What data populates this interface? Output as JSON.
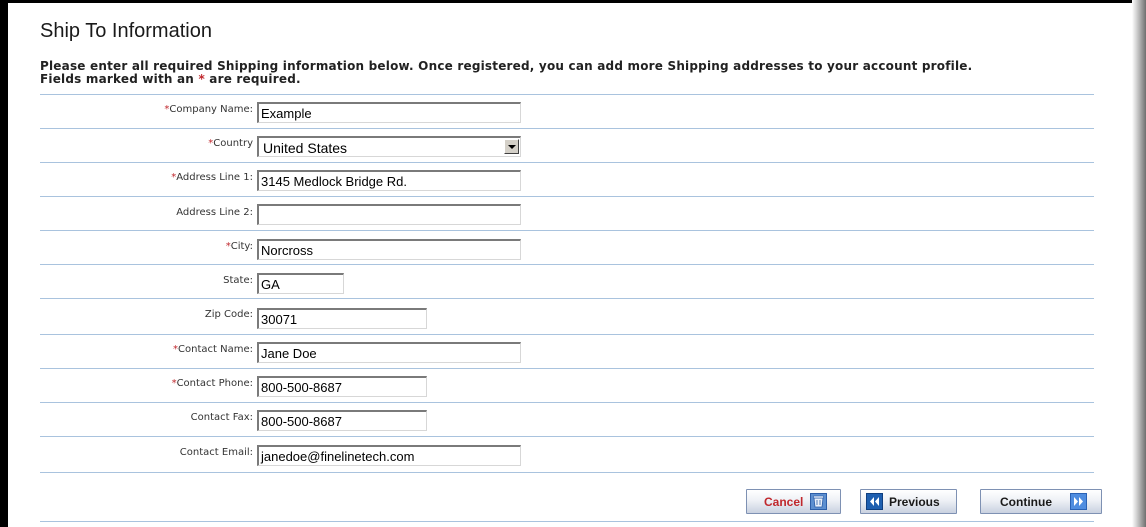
{
  "page": {
    "title": "Ship To Information",
    "intro_line1": "Please enter all required Shipping information below. Once registered, you can add more Shipping addresses to your account profile.",
    "intro_line2_pre": "Fields marked with an ",
    "intro_required_mark": "*",
    "intro_line2_post": " are required."
  },
  "required_mark": "*",
  "fields": {
    "company_name": {
      "label": "Company Name:",
      "value": "Example",
      "required": true
    },
    "country": {
      "label": "Country",
      "value": "United States",
      "required": true
    },
    "address1": {
      "label": "Address Line 1:",
      "value": "3145 Medlock Bridge Rd.",
      "required": true
    },
    "address2": {
      "label": "Address Line 2:",
      "value": "",
      "required": false
    },
    "city": {
      "label": "City:",
      "value": "Norcross",
      "required": true
    },
    "state": {
      "label": "State:",
      "value": "GA",
      "required": false
    },
    "zip": {
      "label": "Zip Code:",
      "value": "30071",
      "required": false
    },
    "contact_name": {
      "label": "Contact Name:",
      "value": "Jane Doe",
      "required": true
    },
    "contact_phone": {
      "label": "Contact Phone:",
      "value": "800-500-8687",
      "required": true
    },
    "contact_fax": {
      "label": "Contact Fax:",
      "value": "800-500-8687",
      "required": false
    },
    "contact_email": {
      "label": "Contact Email:",
      "value": "janedoe@finelinetech.com",
      "required": false
    }
  },
  "buttons": {
    "cancel": "Cancel",
    "previous": "Previous",
    "continue": "Continue"
  },
  "icons": {
    "cancel": "trash-can-icon",
    "previous": "double-chevron-left-icon",
    "continue": "double-chevron-right-icon",
    "country_dropdown": "chevron-down-icon"
  },
  "colors": {
    "required": "#c0282d",
    "separator": "#a9c3de",
    "cancel_text": "#c0282d",
    "icon_blue": "#1e64b4"
  }
}
